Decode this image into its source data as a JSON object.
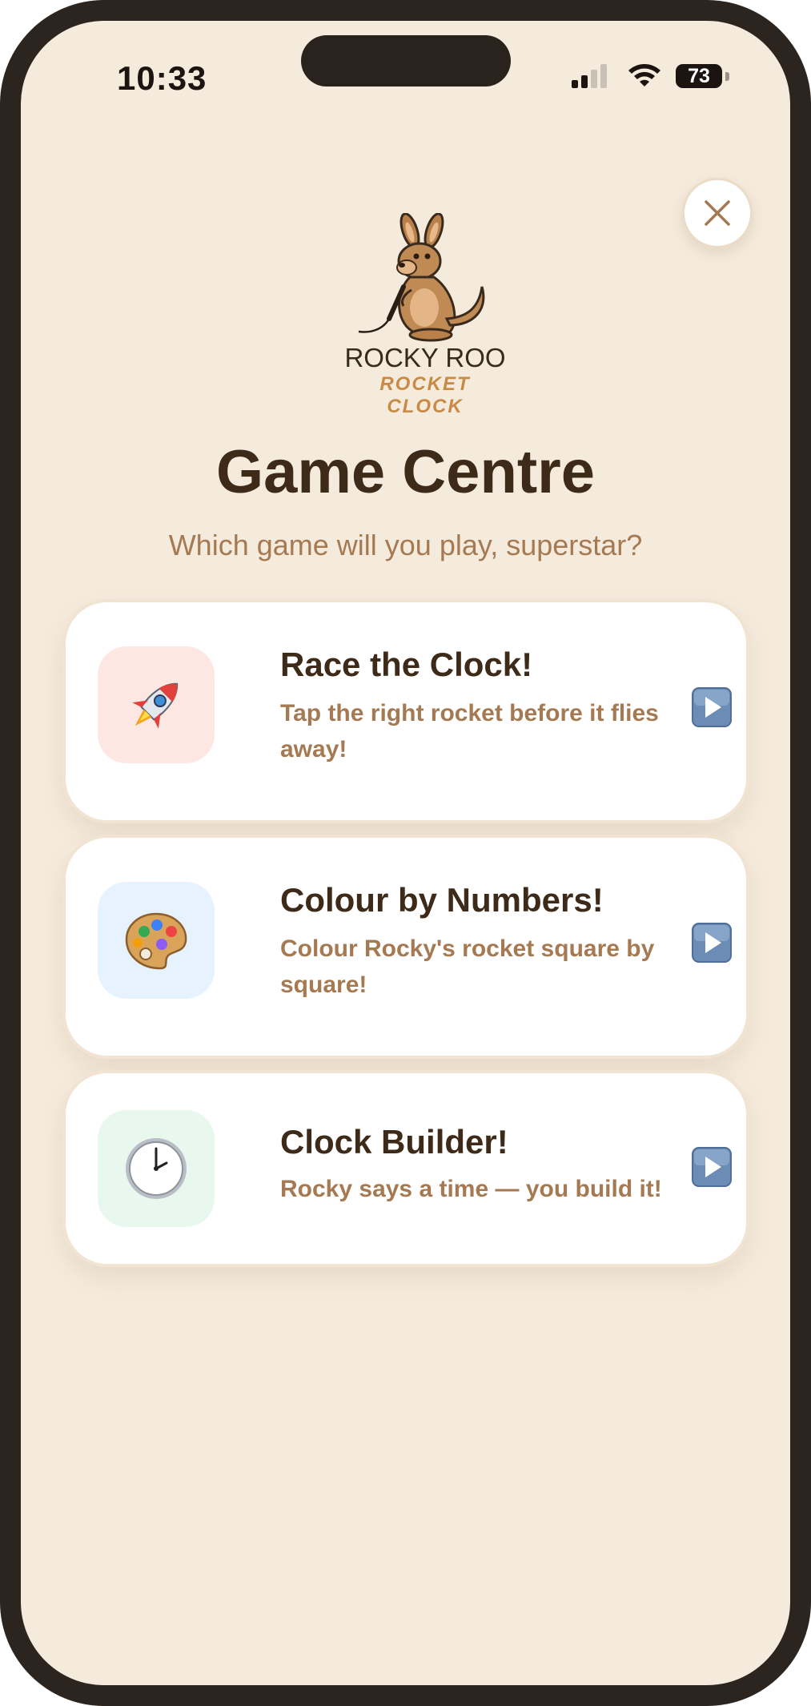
{
  "status_bar": {
    "time": "10:33",
    "battery": "73"
  },
  "header": {
    "close_icon": "close-icon",
    "logo_line1": "ROCKY ROO",
    "logo_line2": "ROCKET CLOCK",
    "title": "Game Centre",
    "subtitle": "Which game will you play, superstar?"
  },
  "games": [
    {
      "title": "Race the Clock!",
      "description": "Tap the right rocket before it flies away!",
      "icon": "rocket-icon",
      "tile_color": "#fde7e3"
    },
    {
      "title": "Colour by Numbers!",
      "description": "Colour Rocky's rocket square by square!",
      "icon": "palette-icon",
      "tile_color": "#e6f2fd"
    },
    {
      "title": "Clock Builder!",
      "description": "Rocky says a time — you build it!",
      "icon": "clock-icon",
      "tile_color": "#e9f8ef"
    }
  ],
  "colors": {
    "background": "#f5ebdd",
    "title": "#3d2a18",
    "muted_text": "#a57a52",
    "play_button": "#6b8db5"
  }
}
